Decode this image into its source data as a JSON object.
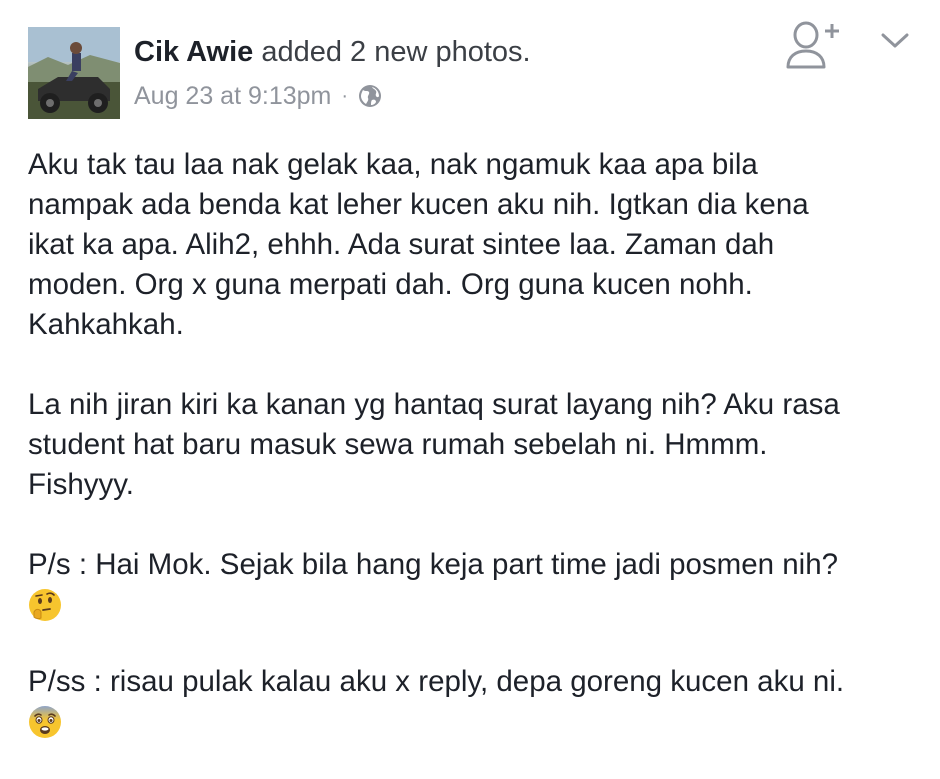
{
  "post": {
    "author": "Cik Awie",
    "action": "added 2 new photos.",
    "timestamp": "Aug 23 at 9:13pm",
    "separator": "·",
    "privacy_icon": "globe-icon"
  },
  "header_icons": {
    "add_friend": "add-friend-icon",
    "menu": "chevron-down-icon"
  },
  "body": {
    "p1": [
      "Aku tak tau laa nak gelak kaa, nak ngamuk kaa apa bila",
      "nampak ada benda kat leher kucen aku nih. Igtkan dia kena",
      "ikat ka apa. Alih2, ehhh. Ada surat sintee laa. Zaman dah",
      "moden. Org x guna merpati dah. Org guna kucen nohh.",
      "Kahkahkah."
    ],
    "p2": [
      "La nih jiran kiri ka kanan yg hantaq surat layang nih? Aku rasa",
      "student hat baru masuk sewa rumah sebelah ni. Hmmm.",
      "Fishyyy."
    ],
    "p3": [
      "P/s : Hai Mok. Sejak bila hang keja part time jadi posmen nih?"
    ],
    "p3_emoji": "thinking-face-emoji",
    "p4": [
      "P/ss : risau pulak kalau aku x reply, depa goreng kucen aku ni."
    ],
    "p4_emoji": "fearful-face-emoji"
  },
  "colors": {
    "text": "#1d2129",
    "meta": "#90949c",
    "icon": "#90949c",
    "emoji_yellow": "#f7c52e"
  }
}
